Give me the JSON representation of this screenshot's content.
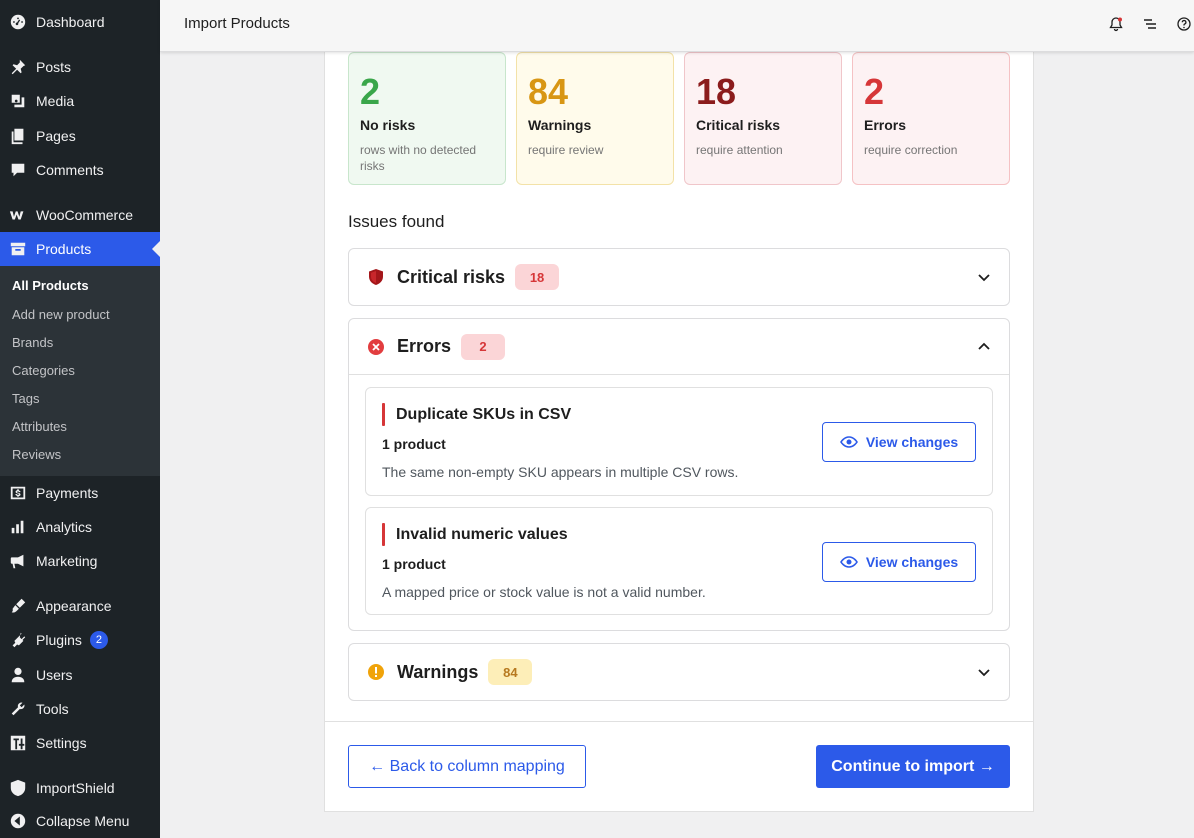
{
  "sidebar": {
    "menu": [
      {
        "label": "Dashboard",
        "icon": "dashboard-icon"
      },
      {
        "label": "Posts",
        "icon": "pin-icon"
      },
      {
        "label": "Media",
        "icon": "media-icon"
      },
      {
        "label": "Pages",
        "icon": "pages-icon"
      },
      {
        "label": "Comments",
        "icon": "comment-icon"
      },
      {
        "label": "WooCommerce",
        "icon": "woo-icon"
      },
      {
        "label": "Products",
        "icon": "archive-icon"
      },
      {
        "label": "Payments",
        "icon": "payment-icon"
      },
      {
        "label": "Analytics",
        "icon": "bar-chart-icon"
      },
      {
        "label": "Marketing",
        "icon": "megaphone-icon"
      },
      {
        "label": "Appearance",
        "icon": "brush-icon"
      },
      {
        "label": "Plugins",
        "icon": "plug-icon",
        "badge": "2"
      },
      {
        "label": "Users",
        "icon": "user-icon"
      },
      {
        "label": "Tools",
        "icon": "wrench-icon"
      },
      {
        "label": "Settings",
        "icon": "sliders-icon"
      },
      {
        "label": "ImportShield",
        "icon": "shield-icon"
      },
      {
        "label": "Collapse Menu",
        "icon": "collapse-icon"
      }
    ],
    "submenu": [
      "All Products",
      "Add new product",
      "Brands",
      "Categories",
      "Tags",
      "Attributes",
      "Reviews"
    ]
  },
  "topbar": {
    "title": "Import Products"
  },
  "stats": [
    {
      "value": "2",
      "label": "No risks",
      "sub": "rows with no detected risks",
      "color": "#3aa64a",
      "bg": "#f0f9f1",
      "border": "#c8e6cc"
    },
    {
      "value": "84",
      "label": "Warnings",
      "sub": "require review",
      "color": "#d89614",
      "bg": "#fffbeb",
      "border": "#f3e2a8"
    },
    {
      "value": "18",
      "label": "Critical risks",
      "sub": "require attention",
      "color": "#8b1c1c",
      "bg": "#fdf2f3",
      "border": "#f0c6ca"
    },
    {
      "value": "2",
      "label": "Errors",
      "sub": "require correction",
      "color": "#d63638",
      "bg": "#fdf2f3",
      "border": "#f5c2c4"
    }
  ],
  "issues_title": "Issues found",
  "accordions": {
    "critical": {
      "title": "Critical risks",
      "count": "18"
    },
    "errors": {
      "title": "Errors",
      "count": "2",
      "items": [
        {
          "title": "Duplicate SKUs in CSV",
          "count": "1 product",
          "desc": "The same non-empty SKU appears in multiple CSV rows.",
          "button": "View changes"
        },
        {
          "title": "Invalid numeric values",
          "count": "1 product",
          "desc": "A mapped price or stock value is not a valid number.",
          "button": "View changes"
        }
      ]
    },
    "warnings": {
      "title": "Warnings",
      "count": "84"
    }
  },
  "footer": {
    "back_label": "← Back to column mapping",
    "continue_label": "Continue to import →"
  },
  "colors": {
    "accent": "#2c5ae9",
    "error": "#d63638",
    "critical": "#a4161a",
    "warning": "#f0a30a"
  }
}
